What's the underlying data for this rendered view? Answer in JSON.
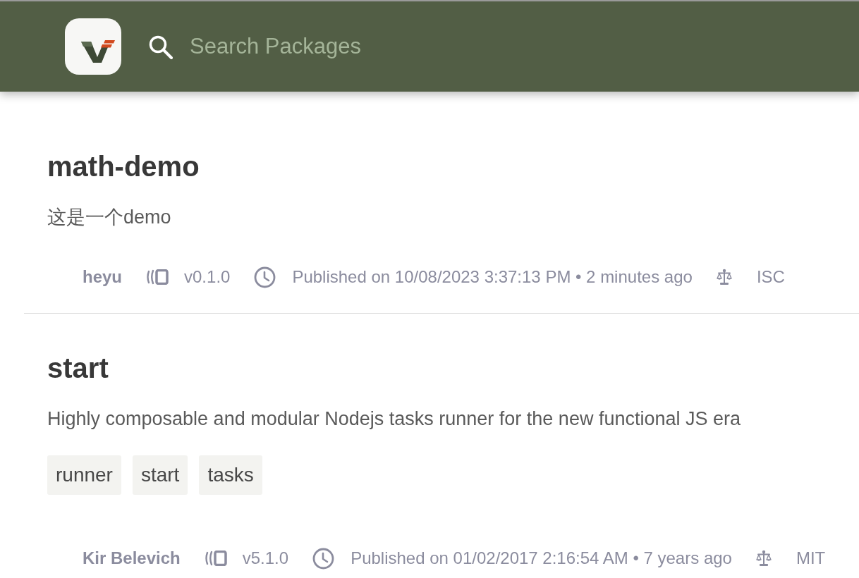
{
  "header": {
    "search": {
      "placeholder": "Search Packages"
    }
  },
  "packages": [
    {
      "name": "math-demo",
      "description": "这是一个demo",
      "author": "heyu",
      "version": "v0.1.0",
      "published": "Published on 10/08/2023 3:37:13 PM • 2 minutes ago",
      "license": "ISC"
    },
    {
      "name": "start",
      "description": "Highly composable and modular Nodejs tasks runner for the new functional JS era",
      "keywords": [
        "runner",
        "start",
        "tasks"
      ],
      "author": "Kir Belevich",
      "version": "v5.1.0",
      "published": "Published on 01/02/2017 2:16:54 AM • 7 years ago",
      "license": "MIT"
    }
  ]
}
